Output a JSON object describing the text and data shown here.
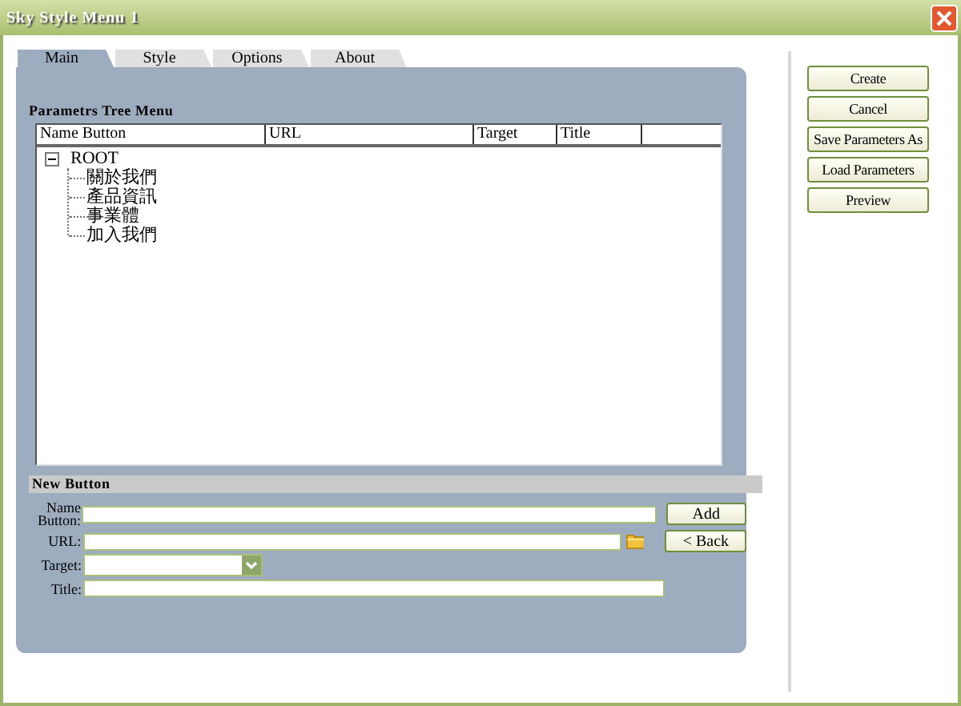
{
  "window": {
    "title": "Sky Style Menu 1"
  },
  "tabs": [
    {
      "label": "Main",
      "selected": true
    },
    {
      "label": "Style",
      "selected": false
    },
    {
      "label": "Options",
      "selected": false
    },
    {
      "label": "About",
      "selected": false
    }
  ],
  "tree_panel": {
    "title": "Parametrs Tree Menu",
    "columns": [
      "Name Button",
      "URL",
      "Target",
      "Title"
    ],
    "root": {
      "label": "ROOT",
      "expanded": true,
      "children": [
        {
          "label": "關於我們"
        },
        {
          "label": "產品資訊"
        },
        {
          "label": "事業體"
        },
        {
          "label": "加入我們"
        }
      ]
    }
  },
  "new_button": {
    "title": "New Button",
    "fields": [
      {
        "kind": "text",
        "label": "Name Button:",
        "button": "Add"
      },
      {
        "kind": "file",
        "label": "URL:",
        "button": "< Back"
      },
      {
        "kind": "select",
        "label": "Target:"
      },
      {
        "kind": "text",
        "label": "Title:"
      }
    ]
  },
  "actions": [
    "Create",
    "Cancel",
    "Save Parameters As",
    "Load Parameters",
    "Preview"
  ]
}
